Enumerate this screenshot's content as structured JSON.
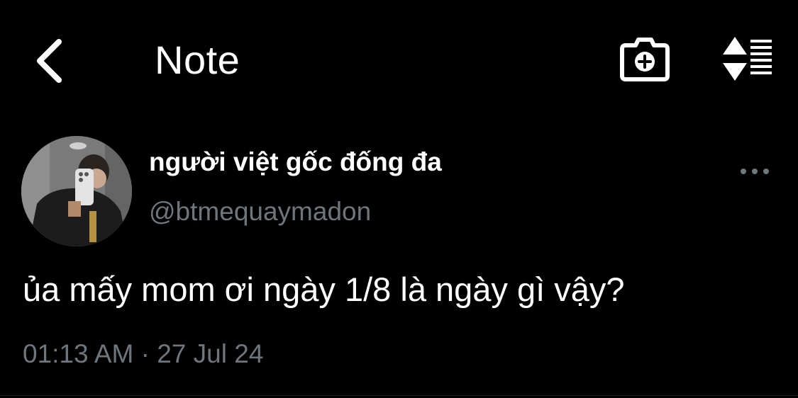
{
  "header": {
    "title": "Note",
    "back_icon": "chevron-left-icon",
    "camera_icon": "camera-add-icon",
    "sort_icon": "sort-list-icon"
  },
  "post": {
    "display_name": "người việt gốc đống đa",
    "handle": "@btmequaymadon",
    "text": "ủa mấy mom ơi ngày 1/8 là ngày gì vậy?",
    "time": "01:13 AM",
    "separator": "·",
    "date": "27 Jul 24"
  },
  "colors": {
    "background": "#000000",
    "primary_text": "#ffffff",
    "secondary_text": "#6e767d"
  }
}
